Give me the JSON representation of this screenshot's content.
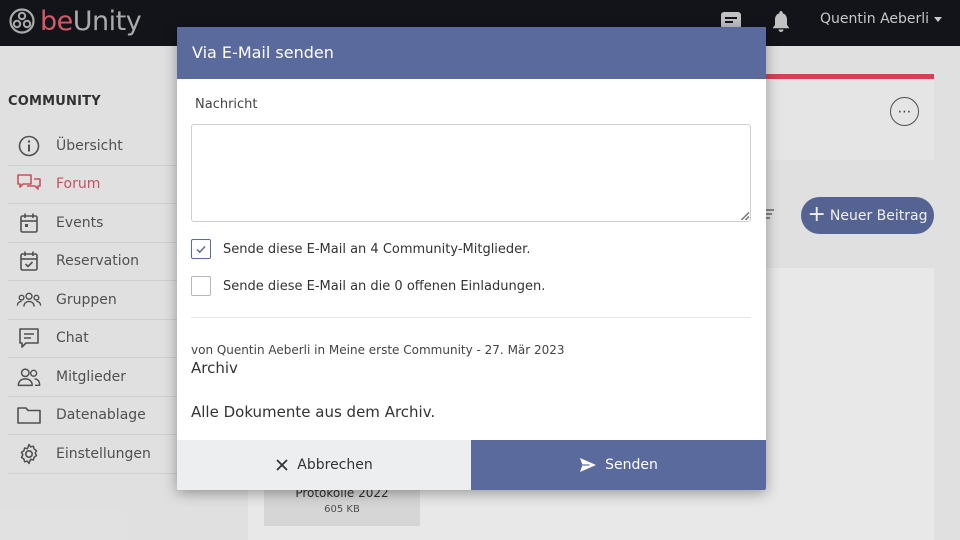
{
  "app": {
    "logo_prefix": "be",
    "logo_suffix": "Unity",
    "user_name": "Quentin Aeberli",
    "brand_color": "#e0606e",
    "accent_color": "#5b6a9d",
    "icons": {
      "messages": "message-square-icon",
      "notifications": "bell-icon",
      "user_menu": "chevron-down-icon"
    }
  },
  "sidebar": {
    "title": "COMMUNITY",
    "active": "Forum",
    "items": [
      {
        "label": "Übersicht",
        "icon": "info-circle-icon"
      },
      {
        "label": "Forum",
        "icon": "chat-bubbles-icon"
      },
      {
        "label": "Events",
        "icon": "calendar-icon"
      },
      {
        "label": "Reservation",
        "icon": "calendar-check-icon"
      },
      {
        "label": "Gruppen",
        "icon": "group-icon"
      },
      {
        "label": "Chat",
        "icon": "chat-icon"
      },
      {
        "label": "Mitglieder",
        "icon": "users-icon"
      },
      {
        "label": "Datenablage",
        "icon": "folder-icon"
      },
      {
        "label": "Einstellungen",
        "icon": "gear-icon"
      }
    ]
  },
  "main": {
    "new_post_label": "Neuer Beitrag",
    "file": {
      "name": "Protokolle 2022",
      "size": "605 KB"
    }
  },
  "modal": {
    "title": "Via E-Mail senden",
    "message_label": "Nachricht",
    "message_value": "",
    "checkbox_members": {
      "label": "Sende diese E-Mail an 4 Community-Mitglieder.",
      "checked": true
    },
    "checkbox_invites": {
      "label": "Sende diese E-Mail an die 0 offenen Einladungen.",
      "checked": false
    },
    "post_meta": "von Quentin Aeberli in Meine erste Community - 27. Mär 2023",
    "post_title": "Archiv",
    "post_body": "Alle Dokumente aus dem Archiv.",
    "cancel_label": "Abbrechen",
    "send_label": "Senden"
  }
}
